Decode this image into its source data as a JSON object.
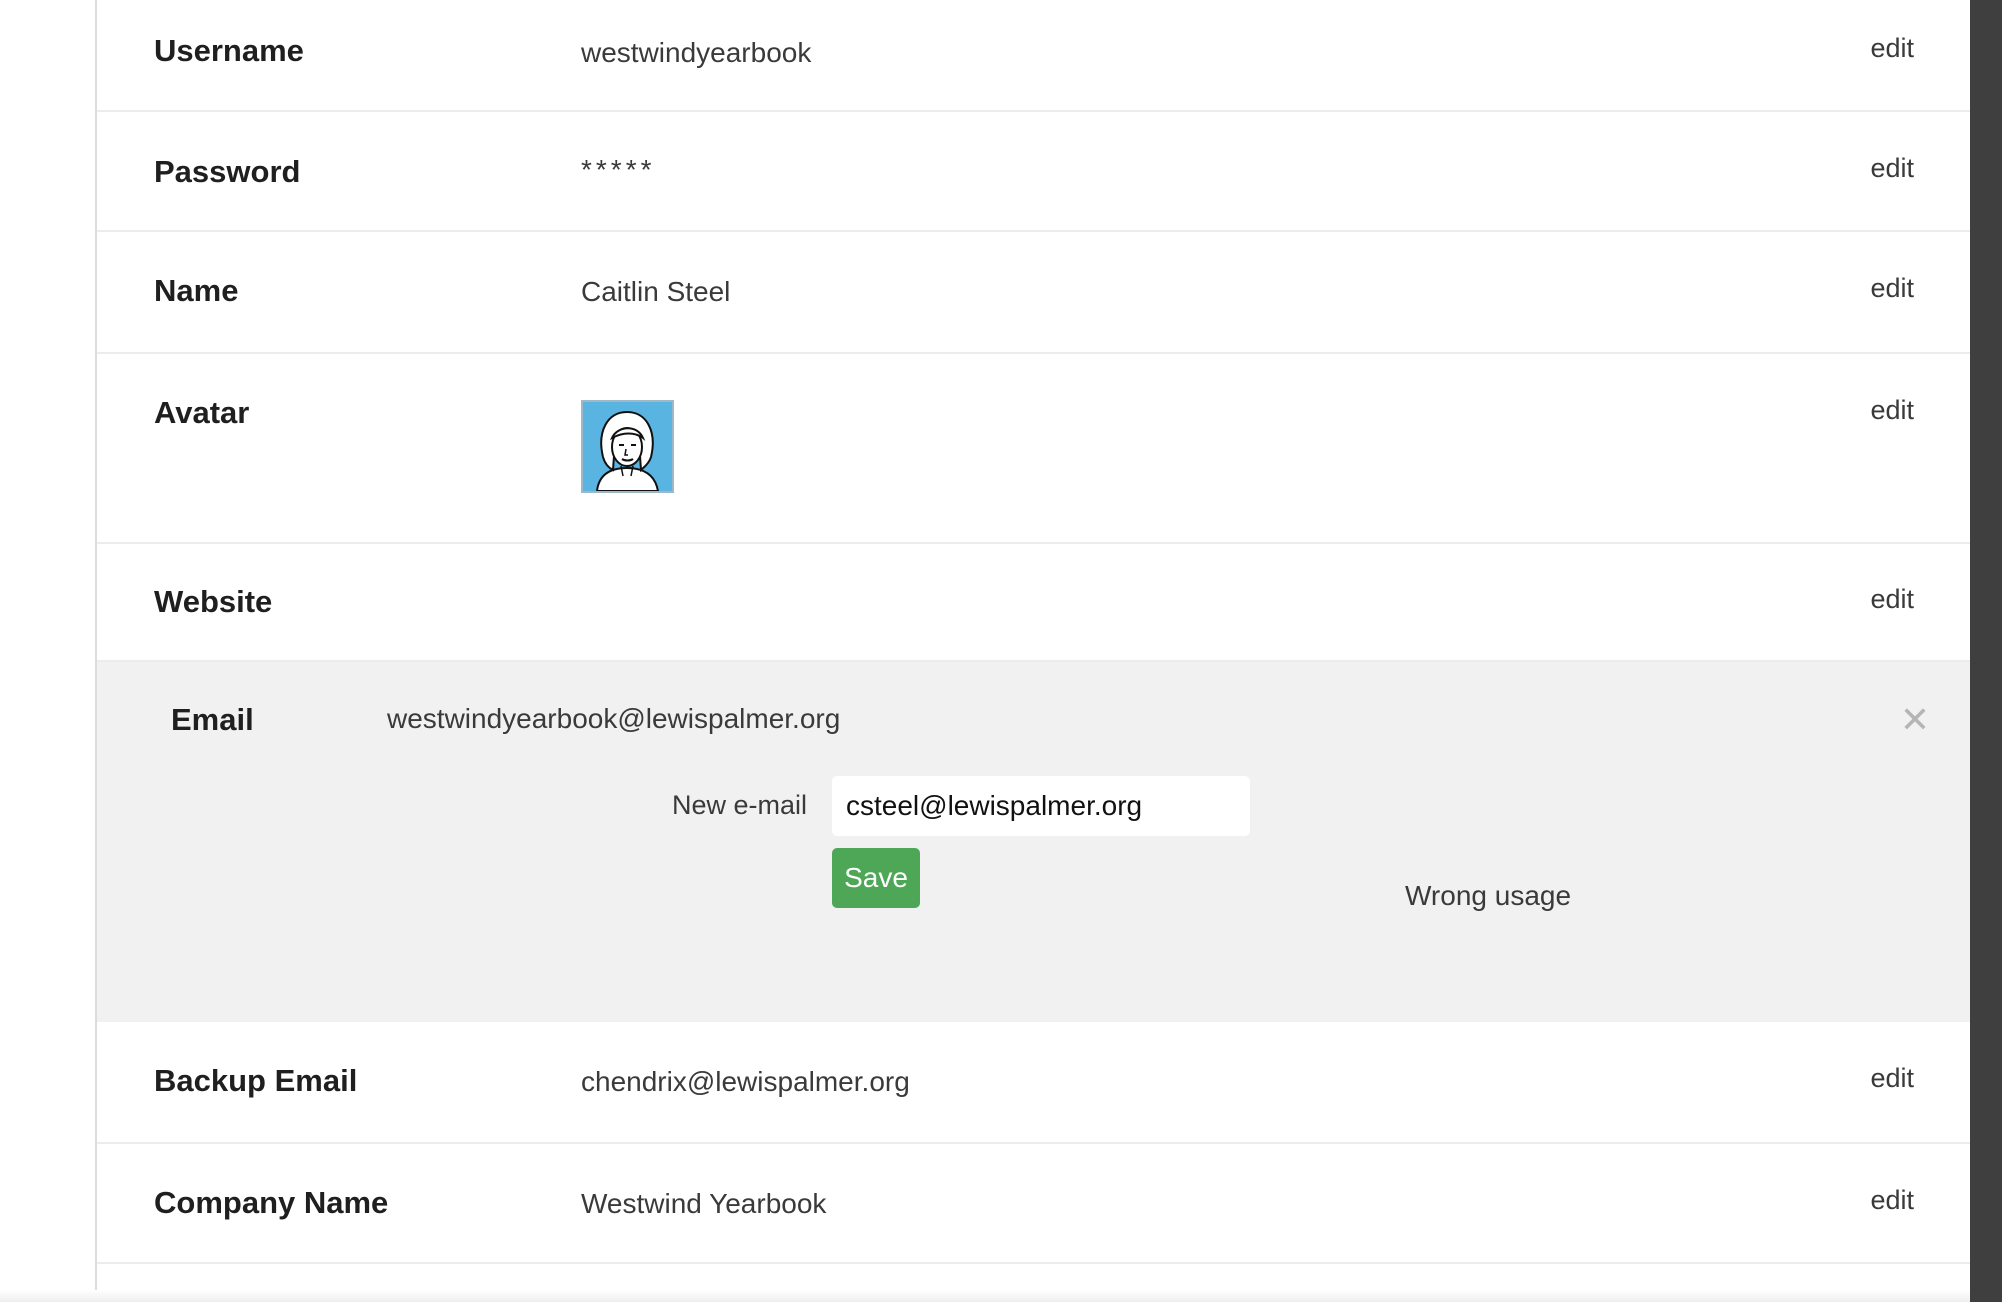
{
  "profile": {
    "rows": {
      "username": {
        "label": "Username",
        "value": "westwindyearbook",
        "action": "edit"
      },
      "password": {
        "label": "Password",
        "value": "*****",
        "action": "edit"
      },
      "name": {
        "label": "Name",
        "value": "Caitlin Steel",
        "action": "edit"
      },
      "avatar": {
        "label": "Avatar",
        "action": "edit",
        "image": "woman-portrait-avatar"
      },
      "website": {
        "label": "Website",
        "value": "",
        "action": "edit"
      },
      "backup_email": {
        "label": "Backup Email",
        "value": "chendrix@lewispalmer.org",
        "action": "edit"
      },
      "company_name": {
        "label": "Company Name",
        "value": "Westwind Yearbook",
        "action": "edit"
      }
    },
    "email_editor": {
      "label": "Email",
      "current_value": "westwindyearbook@lewispalmer.org",
      "new_email_label": "New e-mail",
      "new_email_value": "csteel@lewispalmer.org",
      "save_label": "Save",
      "error_text": "Wrong usage",
      "close_icon": "close-icon"
    }
  },
  "colors": {
    "save_button": "#4ea657",
    "editor_background": "#f1f1f1",
    "avatar_background": "#5ab4e2"
  }
}
